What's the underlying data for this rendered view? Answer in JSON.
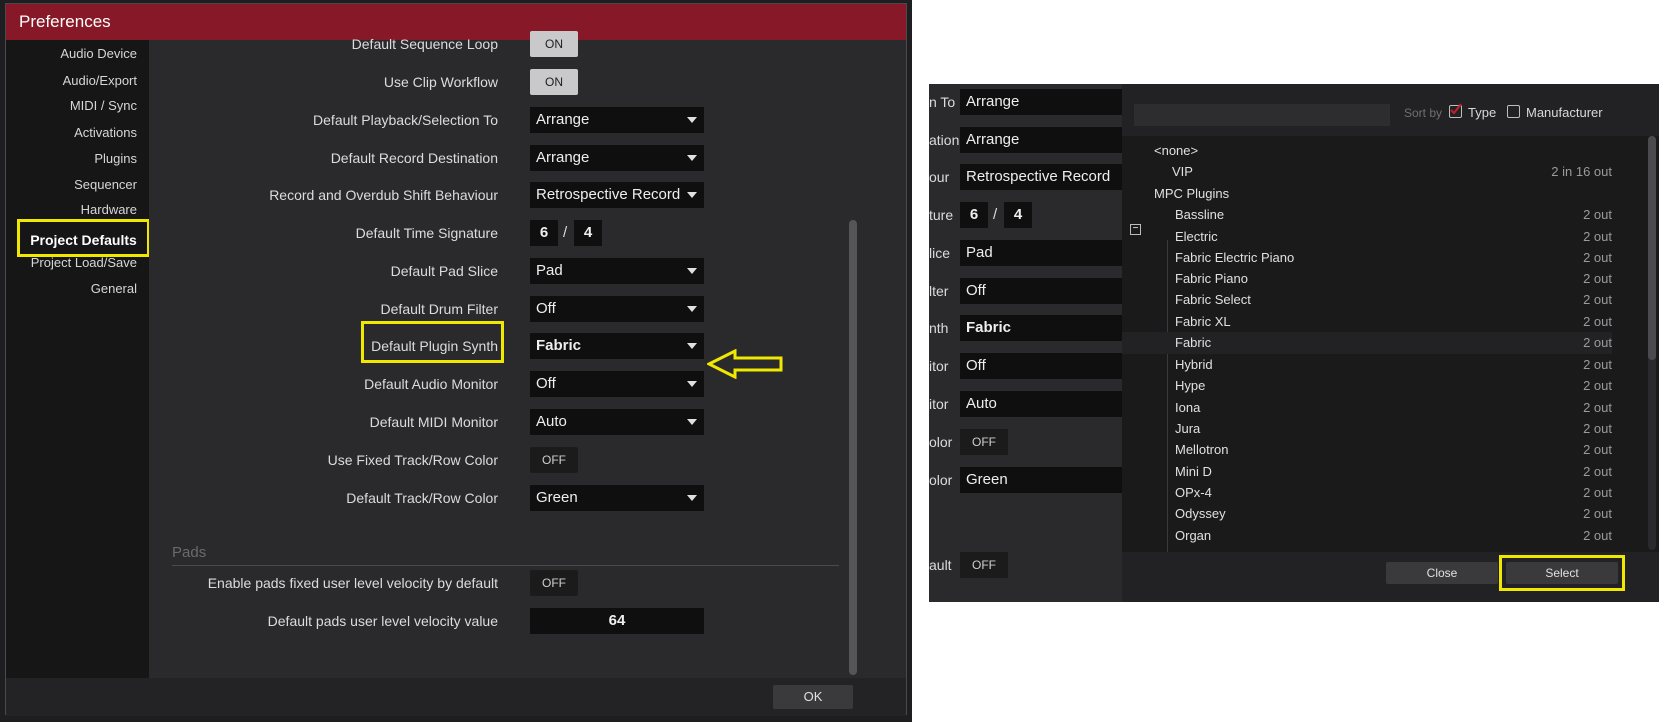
{
  "window": {
    "title": "Preferences"
  },
  "sidebar": {
    "items": [
      {
        "label": "Audio Device"
      },
      {
        "label": "Audio/Export"
      },
      {
        "label": "MIDI / Sync"
      },
      {
        "label": "Activations"
      },
      {
        "label": "Plugins"
      },
      {
        "label": "Sequencer"
      },
      {
        "label": "Hardware"
      },
      {
        "label": "Project Defaults",
        "active": true
      },
      {
        "label": "Project Load/Save"
      },
      {
        "label": "General"
      }
    ]
  },
  "settings": {
    "sequence_loop": {
      "label": "Default Sequence Loop",
      "value": "ON"
    },
    "clip_workflow": {
      "label": "Use Clip Workflow",
      "value": "ON"
    },
    "playback_to": {
      "label": "Default Playback/Selection To",
      "value": "Arrange"
    },
    "record_dest": {
      "label": "Default Record Destination",
      "value": "Arrange"
    },
    "overdub_shift": {
      "label": "Record and Overdub Shift Behaviour",
      "value": "Retrospective Record"
    },
    "time_signature": {
      "label": "Default Time Signature",
      "numerator": "6",
      "separator": "/",
      "denominator": "4"
    },
    "pad_slice": {
      "label": "Default Pad Slice",
      "value": "Pad"
    },
    "drum_filter": {
      "label": "Default Drum Filter",
      "value": "Off"
    },
    "plugin_synth": {
      "label": "Default Plugin Synth",
      "value": "Fabric"
    },
    "audio_monitor": {
      "label": "Default Audio Monitor",
      "value": "Off"
    },
    "midi_monitor": {
      "label": "Default MIDI Monitor",
      "value": "Auto"
    },
    "fixed_color": {
      "label": "Use Fixed Track/Row Color",
      "value": "OFF"
    },
    "row_color": {
      "label": "Default Track/Row Color",
      "value": "Green"
    }
  },
  "pads": {
    "section_title": "Pads",
    "fixed_velocity": {
      "label": "Enable pads fixed user level velocity by default",
      "value": "OFF"
    },
    "velocity_value": {
      "label": "Default pads user level velocity value",
      "value": "64"
    }
  },
  "footer": {
    "ok_label": "OK"
  },
  "browser_background": {
    "rows": [
      {
        "label": "n To",
        "value": "Arrange"
      },
      {
        "label": "ation",
        "value": "Arrange"
      },
      {
        "label": "our",
        "value": "Retrospective Record"
      },
      {
        "label": "ture",
        "num": "6",
        "sep": "/",
        "den": "4"
      },
      {
        "label": "lice",
        "value": "Pad"
      },
      {
        "label": "lter",
        "value": "Off"
      },
      {
        "label": "nth",
        "value": "Fabric"
      },
      {
        "label": "itor",
        "value": "Off"
      },
      {
        "label": "itor",
        "value": "Auto"
      },
      {
        "label": "olor",
        "value": "OFF"
      },
      {
        "label": "olor",
        "value": "Green"
      },
      {
        "label": "ault",
        "value": "OFF"
      }
    ]
  },
  "plugin_browser": {
    "search_placeholder": "",
    "sort_by_label": "Sort by",
    "sort_type_label": "Type",
    "sort_type_checked": true,
    "sort_manufacturer_label": "Manufacturer",
    "sort_manufacturer_checked": false,
    "items": [
      {
        "name": "<none>",
        "io": ""
      },
      {
        "name": "VIP",
        "io": "2 in 16 out"
      },
      {
        "name": "MPC Plugins",
        "io": ""
      },
      {
        "name": "Bassline",
        "io": "2 out"
      },
      {
        "name": "Electric",
        "io": "2 out"
      },
      {
        "name": "Fabric Electric Piano",
        "io": "2 out"
      },
      {
        "name": "Fabric Piano",
        "io": "2 out"
      },
      {
        "name": "Fabric Select",
        "io": "2 out"
      },
      {
        "name": "Fabric XL",
        "io": "2 out"
      },
      {
        "name": "Fabric",
        "io": "2 out"
      },
      {
        "name": "Hybrid",
        "io": "2 out"
      },
      {
        "name": "Hype",
        "io": "2 out"
      },
      {
        "name": "Iona",
        "io": "2 out"
      },
      {
        "name": "Jura",
        "io": "2 out"
      },
      {
        "name": "Mellotron",
        "io": "2 out"
      },
      {
        "name": "Mini D",
        "io": "2 out"
      },
      {
        "name": "OPx-4",
        "io": "2 out"
      },
      {
        "name": "Odyssey",
        "io": "2 out"
      },
      {
        "name": "Organ",
        "io": "2 out"
      }
    ],
    "close_label": "Close",
    "select_label": "Select"
  },
  "colors": {
    "title_bar": "#861827",
    "highlight": "#f0e800",
    "background": "#2a2a2c",
    "field": "#0f0f10"
  }
}
